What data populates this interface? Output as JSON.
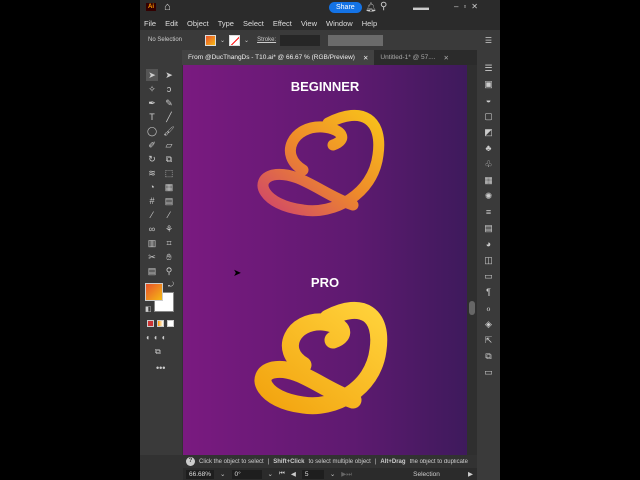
{
  "app": {
    "logo": "Ai",
    "share_label": "Share"
  },
  "menu": [
    "File",
    "Edit",
    "Object",
    "Type",
    "Select",
    "Effect",
    "View",
    "Window",
    "Help"
  ],
  "control": {
    "selection": "No Selection",
    "stroke_label": "Stroke:"
  },
  "tabs": [
    {
      "label": "From @DucThangDs - T10.ai* @ 66.67 % (RGB/Preview)",
      "active": true
    },
    {
      "label": "Untitled-1* @ 57....",
      "active": false
    }
  ],
  "canvas": {
    "heading1": "BEGINNER",
    "heading2": "PRO"
  },
  "hint": {
    "part1": "Click the object to select",
    "sep": "|",
    "part2_bold": "Shift+Click",
    "part2": "to select multiple object",
    "part3_bold": "Alt+Drag",
    "part3": "the object to duplicate"
  },
  "bottom": {
    "zoom": "66.68%",
    "rotation": "0°",
    "artboard": "5",
    "mode": "Selection"
  },
  "colors": {
    "fill_start": "#e8522a",
    "fill_end": "#f5b915",
    "accent": "#1473e6"
  }
}
